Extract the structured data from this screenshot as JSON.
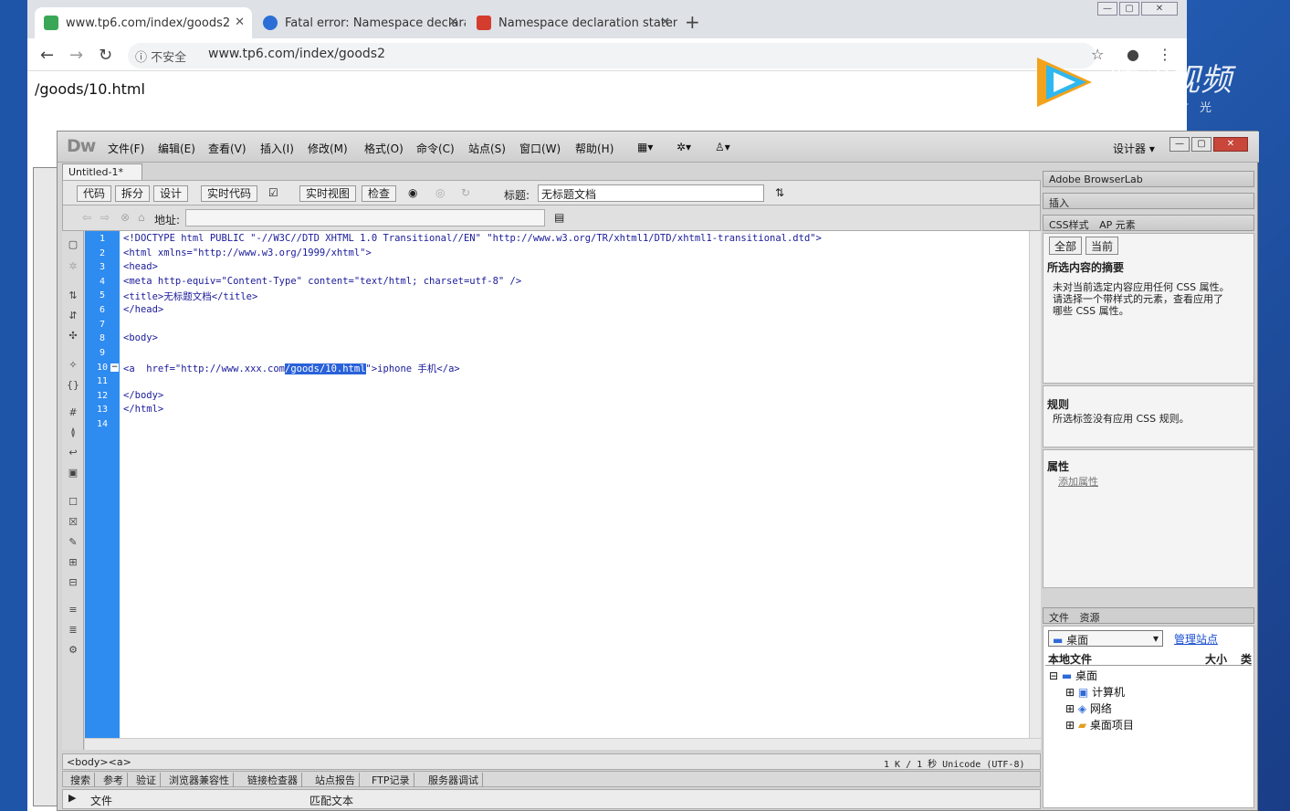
{
  "browser": {
    "tabs": [
      {
        "title": "www.tp6.com/index/goods2",
        "icon": "site-icon",
        "color": "#3aa757"
      },
      {
        "title": "Fatal error: Namespace declara",
        "icon": "paw-icon",
        "color": "#2b6fd6"
      },
      {
        "title": "Namespace declaration statem",
        "icon": "csdn-icon",
        "color": "#d43c2e"
      }
    ],
    "security_label": "不安全",
    "url": "www.tp6.com/index/goods2",
    "page_text": "/goods/10.html"
  },
  "watermark": {
    "name": "腾讯视频",
    "slogan": "不负好时光"
  },
  "dw": {
    "logo": "Dw",
    "menus": [
      "文件(F)",
      "编辑(E)",
      "查看(V)",
      "插入(I)",
      "修改(M)",
      "格式(O)",
      "命令(C)",
      "站点(S)",
      "窗口(W)",
      "帮助(H)"
    ],
    "workspace": "设计器",
    "doc_tab": "Untitled-1*",
    "view_buttons": [
      "代码",
      "拆分",
      "设计",
      "实时代码",
      "实时视图",
      "检查"
    ],
    "title_label": "标题:",
    "title_value": "无标题文档",
    "address_label": "地址:",
    "code_lines": [
      "<!DOCTYPE html PUBLIC \"-//W3C//DTD XHTML 1.0 Transitional//EN\" \"http://www.w3.org/TR/xhtml1/DTD/xhtml1-transitional.dtd\">",
      "<html xmlns=\"http://www.w3.org/1999/xhtml\">",
      "<head>",
      "<meta http-equiv=\"Content-Type\" content=\"text/html; charset=utf-8\" />",
      "<title>无标题文档</title>",
      "</head>",
      "",
      "<body>",
      "",
      "",
      "",
      "</body>",
      "</html>",
      ""
    ],
    "line10": {
      "before": "<a  href=\"http://www.xxx.com",
      "selected": "/goods/10.html",
      "after": "\">iphone 手机</a>"
    },
    "line_numbers": [
      "1",
      "2",
      "3",
      "4",
      "5",
      "6",
      "7",
      "8",
      "9",
      "10",
      "11",
      "12",
      "13",
      "14"
    ],
    "status_path": "<body><a>",
    "status_info": "1 K / 1 秒 Unicode (UTF-8)",
    "bottom_tabs": [
      "搜索",
      "参考",
      "验证",
      "浏览器兼容性",
      "链接检查器",
      "站点报告",
      "FTP记录",
      "服务器调试"
    ],
    "bottom_col1": "文件",
    "bottom_col2": "匹配文本"
  },
  "panels": {
    "browserlab": "Adobe BrowserLab",
    "insert": "插入",
    "css_tab": "CSS样式",
    "ap_tab": "AP 元素",
    "btn_all": "全部",
    "btn_current": "当前",
    "summary_title": "所选内容的摘要",
    "summary_text1": "未对当前选定内容应用任何 CSS 属性。",
    "summary_text2": "请选择一个带样式的元素，查看应用了",
    "summary_text3": "哪些 CSS 属性。",
    "rules_title": "规则",
    "rules_text": "所选标签没有应用 CSS 规则。",
    "props_title": "属性",
    "add_prop": "添加属性",
    "files_tab": "文件",
    "assets_tab": "资源",
    "site_select": "桌面",
    "manage_sites": "管理站点",
    "local_files": "本地文件",
    "size_col": "大小",
    "type_col": "类",
    "tree": [
      "桌面",
      "计算机",
      "网络",
      "桌面项目"
    ]
  }
}
